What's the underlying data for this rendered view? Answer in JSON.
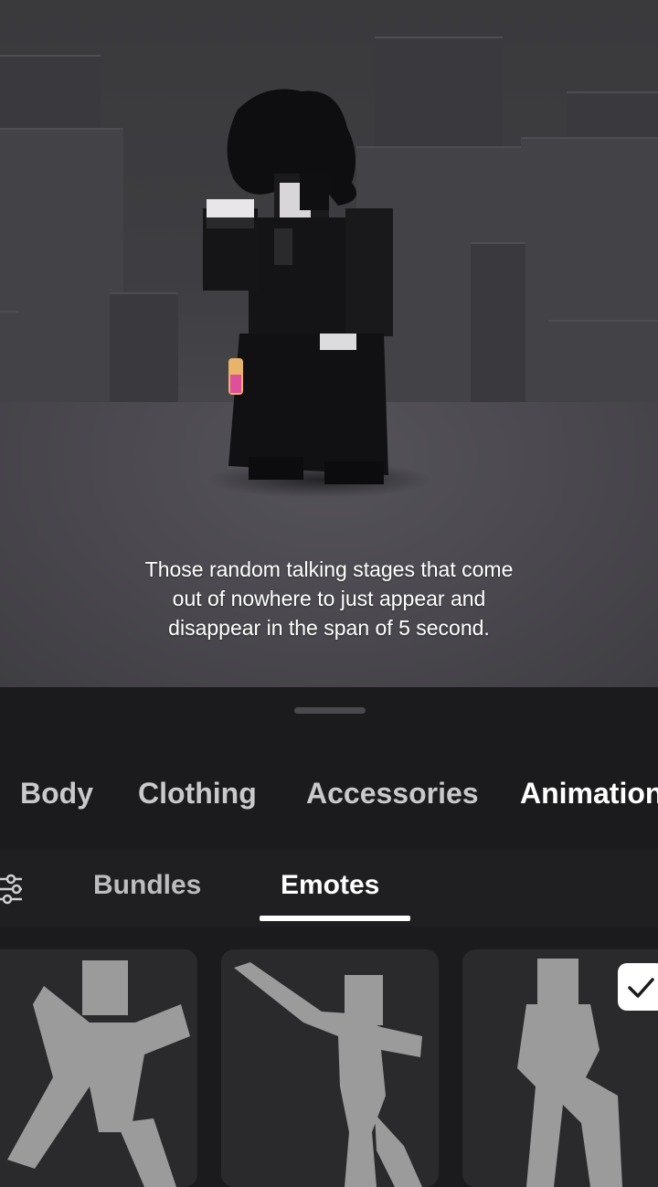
{
  "caption": "Those random talking stages that come out of nowhere to just appear and disappear in the span of 5 second.",
  "categories": [
    {
      "label": "Body",
      "active": false
    },
    {
      "label": "Clothing",
      "active": false
    },
    {
      "label": "Accessories",
      "active": false
    },
    {
      "label": "Animations",
      "active": true
    }
  ],
  "subtabs": [
    {
      "label": "Bundles",
      "active": false
    },
    {
      "label": "Emotes",
      "active": true
    }
  ],
  "emotes": [
    {
      "icon": "emote-lunge-icon",
      "selected": false
    },
    {
      "icon": "emote-dab-icon",
      "selected": false
    },
    {
      "icon": "emote-idle-icon",
      "selected": true
    }
  ],
  "colors": {
    "panel_bg": "#1b1b1d",
    "card_bg": "#2a2a2d",
    "emote_silhouette": "#9b9b9b",
    "active_text": "#ffffff",
    "inactive_text": "#c9c9cc"
  }
}
